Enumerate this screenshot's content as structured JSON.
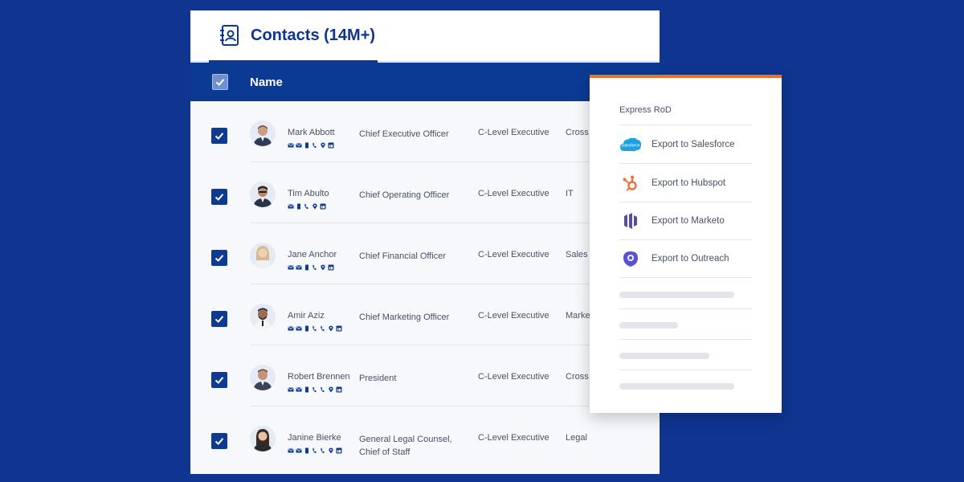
{
  "header": {
    "tab_title": "Contacts (14M+)"
  },
  "table": {
    "name_header": "Name",
    "rows": [
      {
        "name": "Mark Abbott",
        "title": "Chief Executive Officer",
        "title2": "",
        "level": "C-Level Executive",
        "dept": "Cross",
        "contact_icons": [
          "mail-icon",
          "mail-icon",
          "mobile-icon",
          "phone-icon",
          "location-icon",
          "linkedin-icon"
        ]
      },
      {
        "name": "Tim Abulto",
        "title": "Chief Operating Officer",
        "title2": "",
        "level": "C-Level Executive",
        "dept": "IT",
        "contact_icons": [
          "mail-icon",
          "mobile-icon",
          "phone-icon",
          "location-icon",
          "linkedin-icon"
        ]
      },
      {
        "name": "Jane Anchor",
        "title": "Chief Financial Officer",
        "title2": "",
        "level": "C-Level Executive",
        "dept": "Sales",
        "contact_icons": [
          "mail-icon",
          "mail-icon",
          "mobile-icon",
          "phone-icon",
          "location-icon",
          "linkedin-icon"
        ]
      },
      {
        "name": "Amir Aziz",
        "title": "Chief Marketing Officer",
        "title2": "",
        "level": "C-Level Executive",
        "dept": "Marke",
        "contact_icons": [
          "mail-icon",
          "mail-icon",
          "mobile-icon",
          "phone-icon",
          "phone-icon",
          "location-icon",
          "linkedin-icon"
        ]
      },
      {
        "name": "Robert Brennen",
        "title": "President",
        "title2": "",
        "level": "C-Level Executive",
        "dept": "Cross",
        "contact_icons": [
          "mail-icon",
          "mail-icon",
          "mobile-icon",
          "phone-icon",
          "phone-icon",
          "location-icon",
          "linkedin-icon"
        ]
      },
      {
        "name": "Janine Bierke",
        "title": "General Legal Counsel,",
        "title2": "Chief of Staff",
        "level": "C-Level Executive",
        "dept": "Legal",
        "contact_icons": [
          "mail-icon",
          "mail-icon",
          "mobile-icon",
          "phone-icon",
          "phone-icon",
          "location-icon",
          "linkedin-icon"
        ]
      }
    ]
  },
  "export_panel": {
    "title": "Express RoD",
    "items": [
      {
        "label": "Export to Salesforce",
        "icon": "salesforce-icon"
      },
      {
        "label": "Export to Hubspot",
        "icon": "hubspot-icon"
      },
      {
        "label": "Export to Marketo",
        "icon": "marketo-icon"
      },
      {
        "label": "Export to Outreach",
        "icon": "outreach-icon"
      }
    ]
  },
  "colors": {
    "background": "#0f3591",
    "header_bar": "#0b3a93",
    "accent": "#e8712b",
    "text": "#4a5063"
  }
}
